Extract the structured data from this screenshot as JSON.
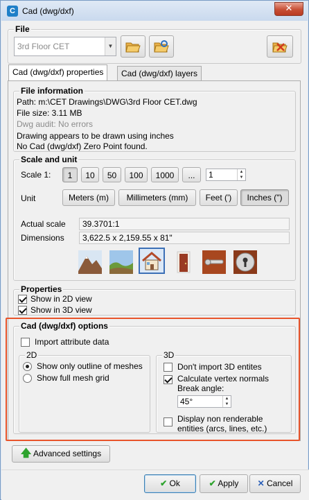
{
  "window": {
    "title": "Cad (dwg/dxf)",
    "close_label": "✕"
  },
  "file": {
    "legend": "File",
    "combo_value": "3rd Floor CET"
  },
  "tabs": [
    {
      "label": "Cad (dwg/dxf) properties",
      "active": true
    },
    {
      "label": "Cad (dwg/dxf) layers",
      "active": false
    }
  ],
  "file_information": {
    "legend": "File information",
    "path": "Path: m:\\CET Drawings\\DWG\\3rd Floor CET.dwg",
    "size": "File size: 3.11 MB",
    "audit": "Dwg audit: No errors",
    "note1": "Drawing appears to be drawn using inches",
    "note2": "No Cad (dwg/dxf) Zero Point found."
  },
  "scale_unit": {
    "legend": "Scale and unit",
    "scale_label": "Scale 1:",
    "scale_buttons": [
      "1",
      "10",
      "50",
      "100",
      "1000",
      "..."
    ],
    "scale_value": "1",
    "unit_label": "Unit",
    "unit_buttons": [
      "Meters (m)",
      "Millimeters (mm)",
      "Feet (')",
      "Inches (\")"
    ],
    "unit_selected": "Inches (\")",
    "actual_scale_label": "Actual scale",
    "actual_scale_value": "39.3701:1",
    "dimensions_label": "Dimensions",
    "dimensions_value": "3,622.5 x 2,159.55 x 81\"",
    "reference_icons": [
      "mountain-icon",
      "landscape-icon",
      "house-icon",
      "door-icon",
      "door-handle-icon",
      "keyhole-icon"
    ]
  },
  "properties": {
    "legend": "Properties",
    "show_2d": "Show in 2D view",
    "show_3d": "Show in 3D view"
  },
  "options": {
    "legend": "Cad (dwg/dxf) options",
    "import_attr": "Import attribute data",
    "group_2d": "2D",
    "outline": "Show only outline of meshes",
    "full_grid": "Show full mesh grid",
    "group_3d": "3D",
    "dont_import": "Don't import 3D entites",
    "calc_normals": "Calculate vertex normals",
    "break_angle": "Break angle:",
    "break_value": "45°",
    "non_render_1": "Display non renderable",
    "non_render_2": "entities (arcs, lines, etc.)"
  },
  "advanced": "Advanced settings",
  "footer": {
    "ok": "Ok",
    "apply": "Apply",
    "cancel": "Cancel"
  },
  "colors": {
    "highlight": "#e8542b",
    "accent": "#1f7fc8"
  }
}
